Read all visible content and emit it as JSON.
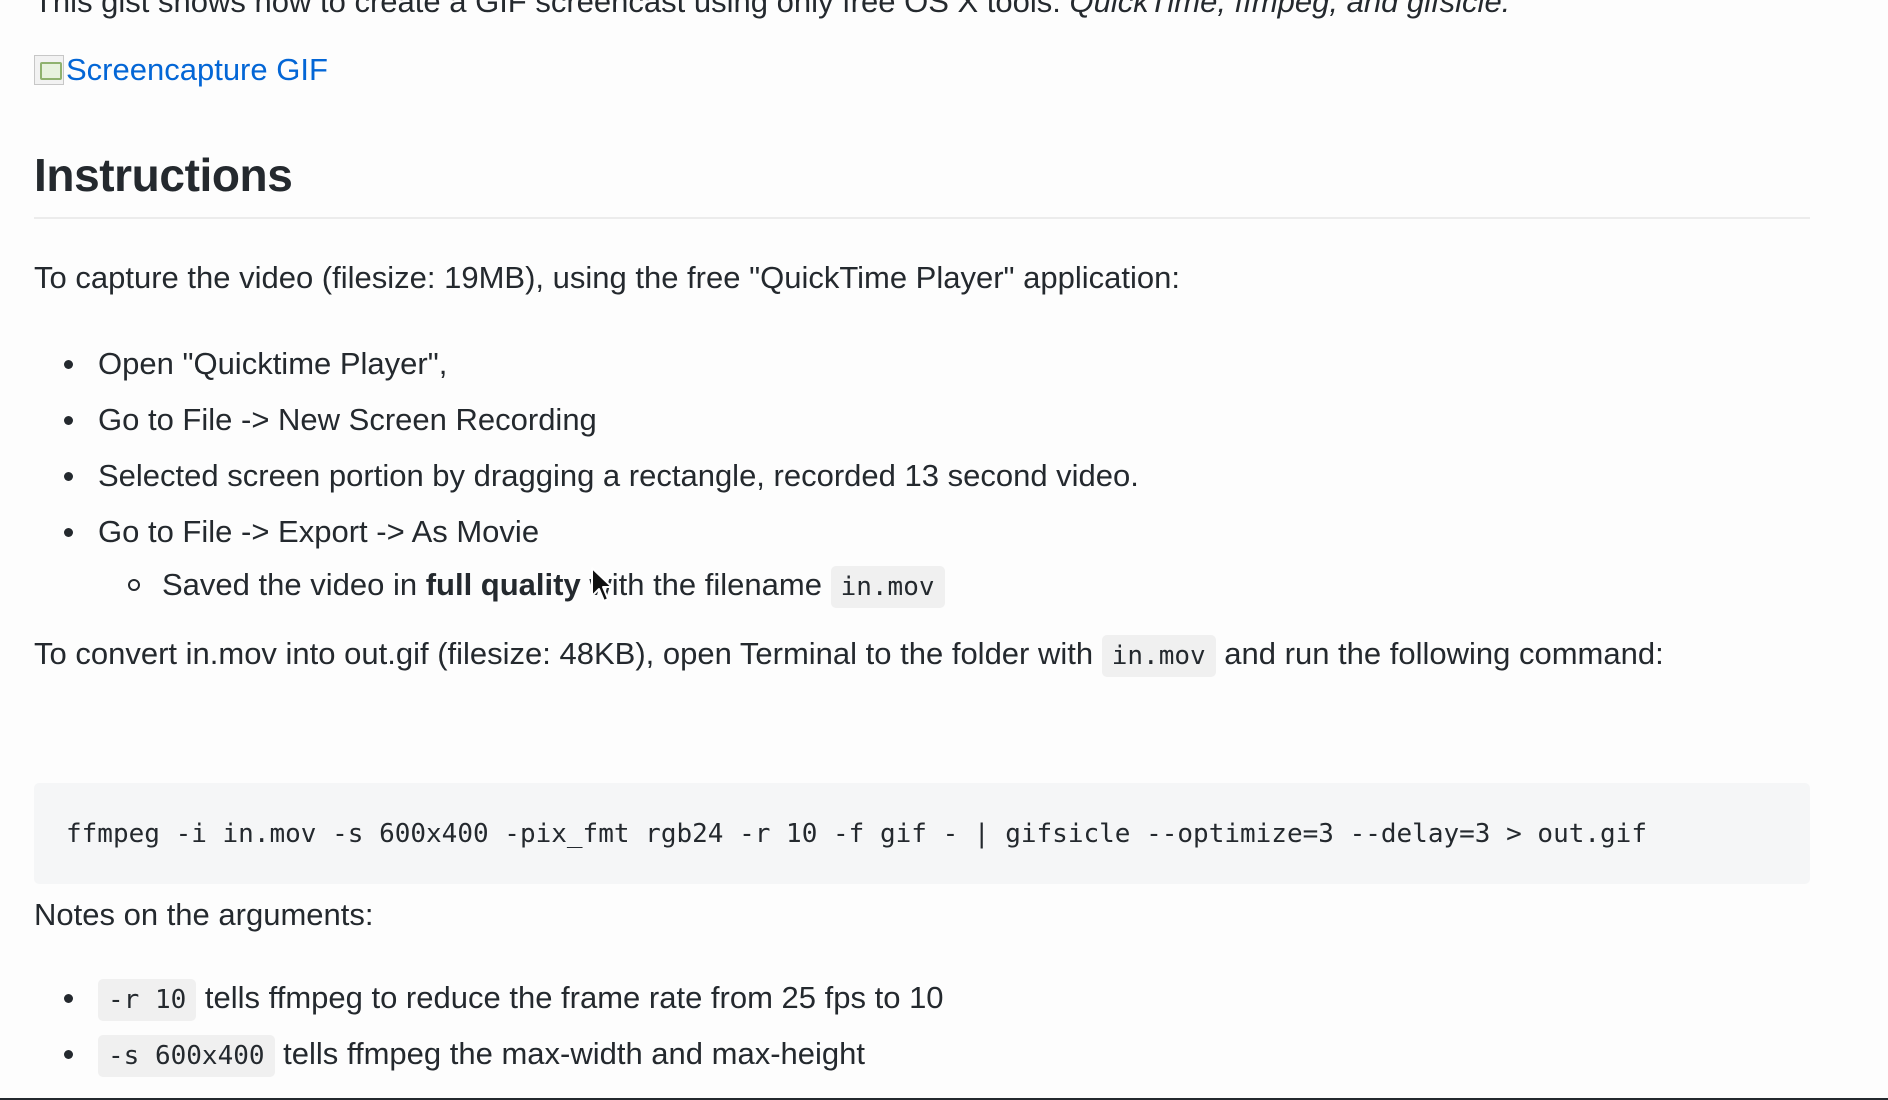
{
  "intro": {
    "text_start": "This gist shows how to create a GIF screencast using only free OS X tools:",
    "tools": "QuickTime, ffmpeg, and gifsicle."
  },
  "hero": {
    "link_text": "Screencapture GIF"
  },
  "heading": "Instructions",
  "capture_paragraph": "To capture the video (filesize: 19MB), using the free \"QuickTime Player\" application:",
  "steps": [
    "Open \"Quicktime Player\",",
    "Go to File -> New Screen Recording",
    "Selected screen portion by dragging a rectangle, recorded 13 second video.",
    "Go to File -> Export -> As Movie"
  ],
  "substep": {
    "before": "Saved the video in",
    "bold": "full quality",
    "middle": "with the filename",
    "code": "in.mov"
  },
  "convert_paragraph": {
    "before": "To convert in.mov into out.gif (filesize: 48KB), open Terminal to the folder with",
    "code": "in.mov",
    "after": "and run the following command:"
  },
  "command": "ffmpeg -i in.mov -s 600x400 -pix_fmt rgb24 -r 10 -f gif - | gifsicle --optimize=3 --delay=3 > out.gif",
  "notes_heading": "Notes on the arguments:",
  "notes": [
    {
      "code": "-r 10",
      "text": "tells ffmpeg to reduce the frame rate from 25 fps to 10"
    },
    {
      "code": "-s 600x400",
      "text": "tells ffmpeg the max-width and max-height"
    }
  ],
  "colors": {
    "link": "#0366d6",
    "text": "#24292e",
    "code_bg": "#f5f6f7"
  }
}
